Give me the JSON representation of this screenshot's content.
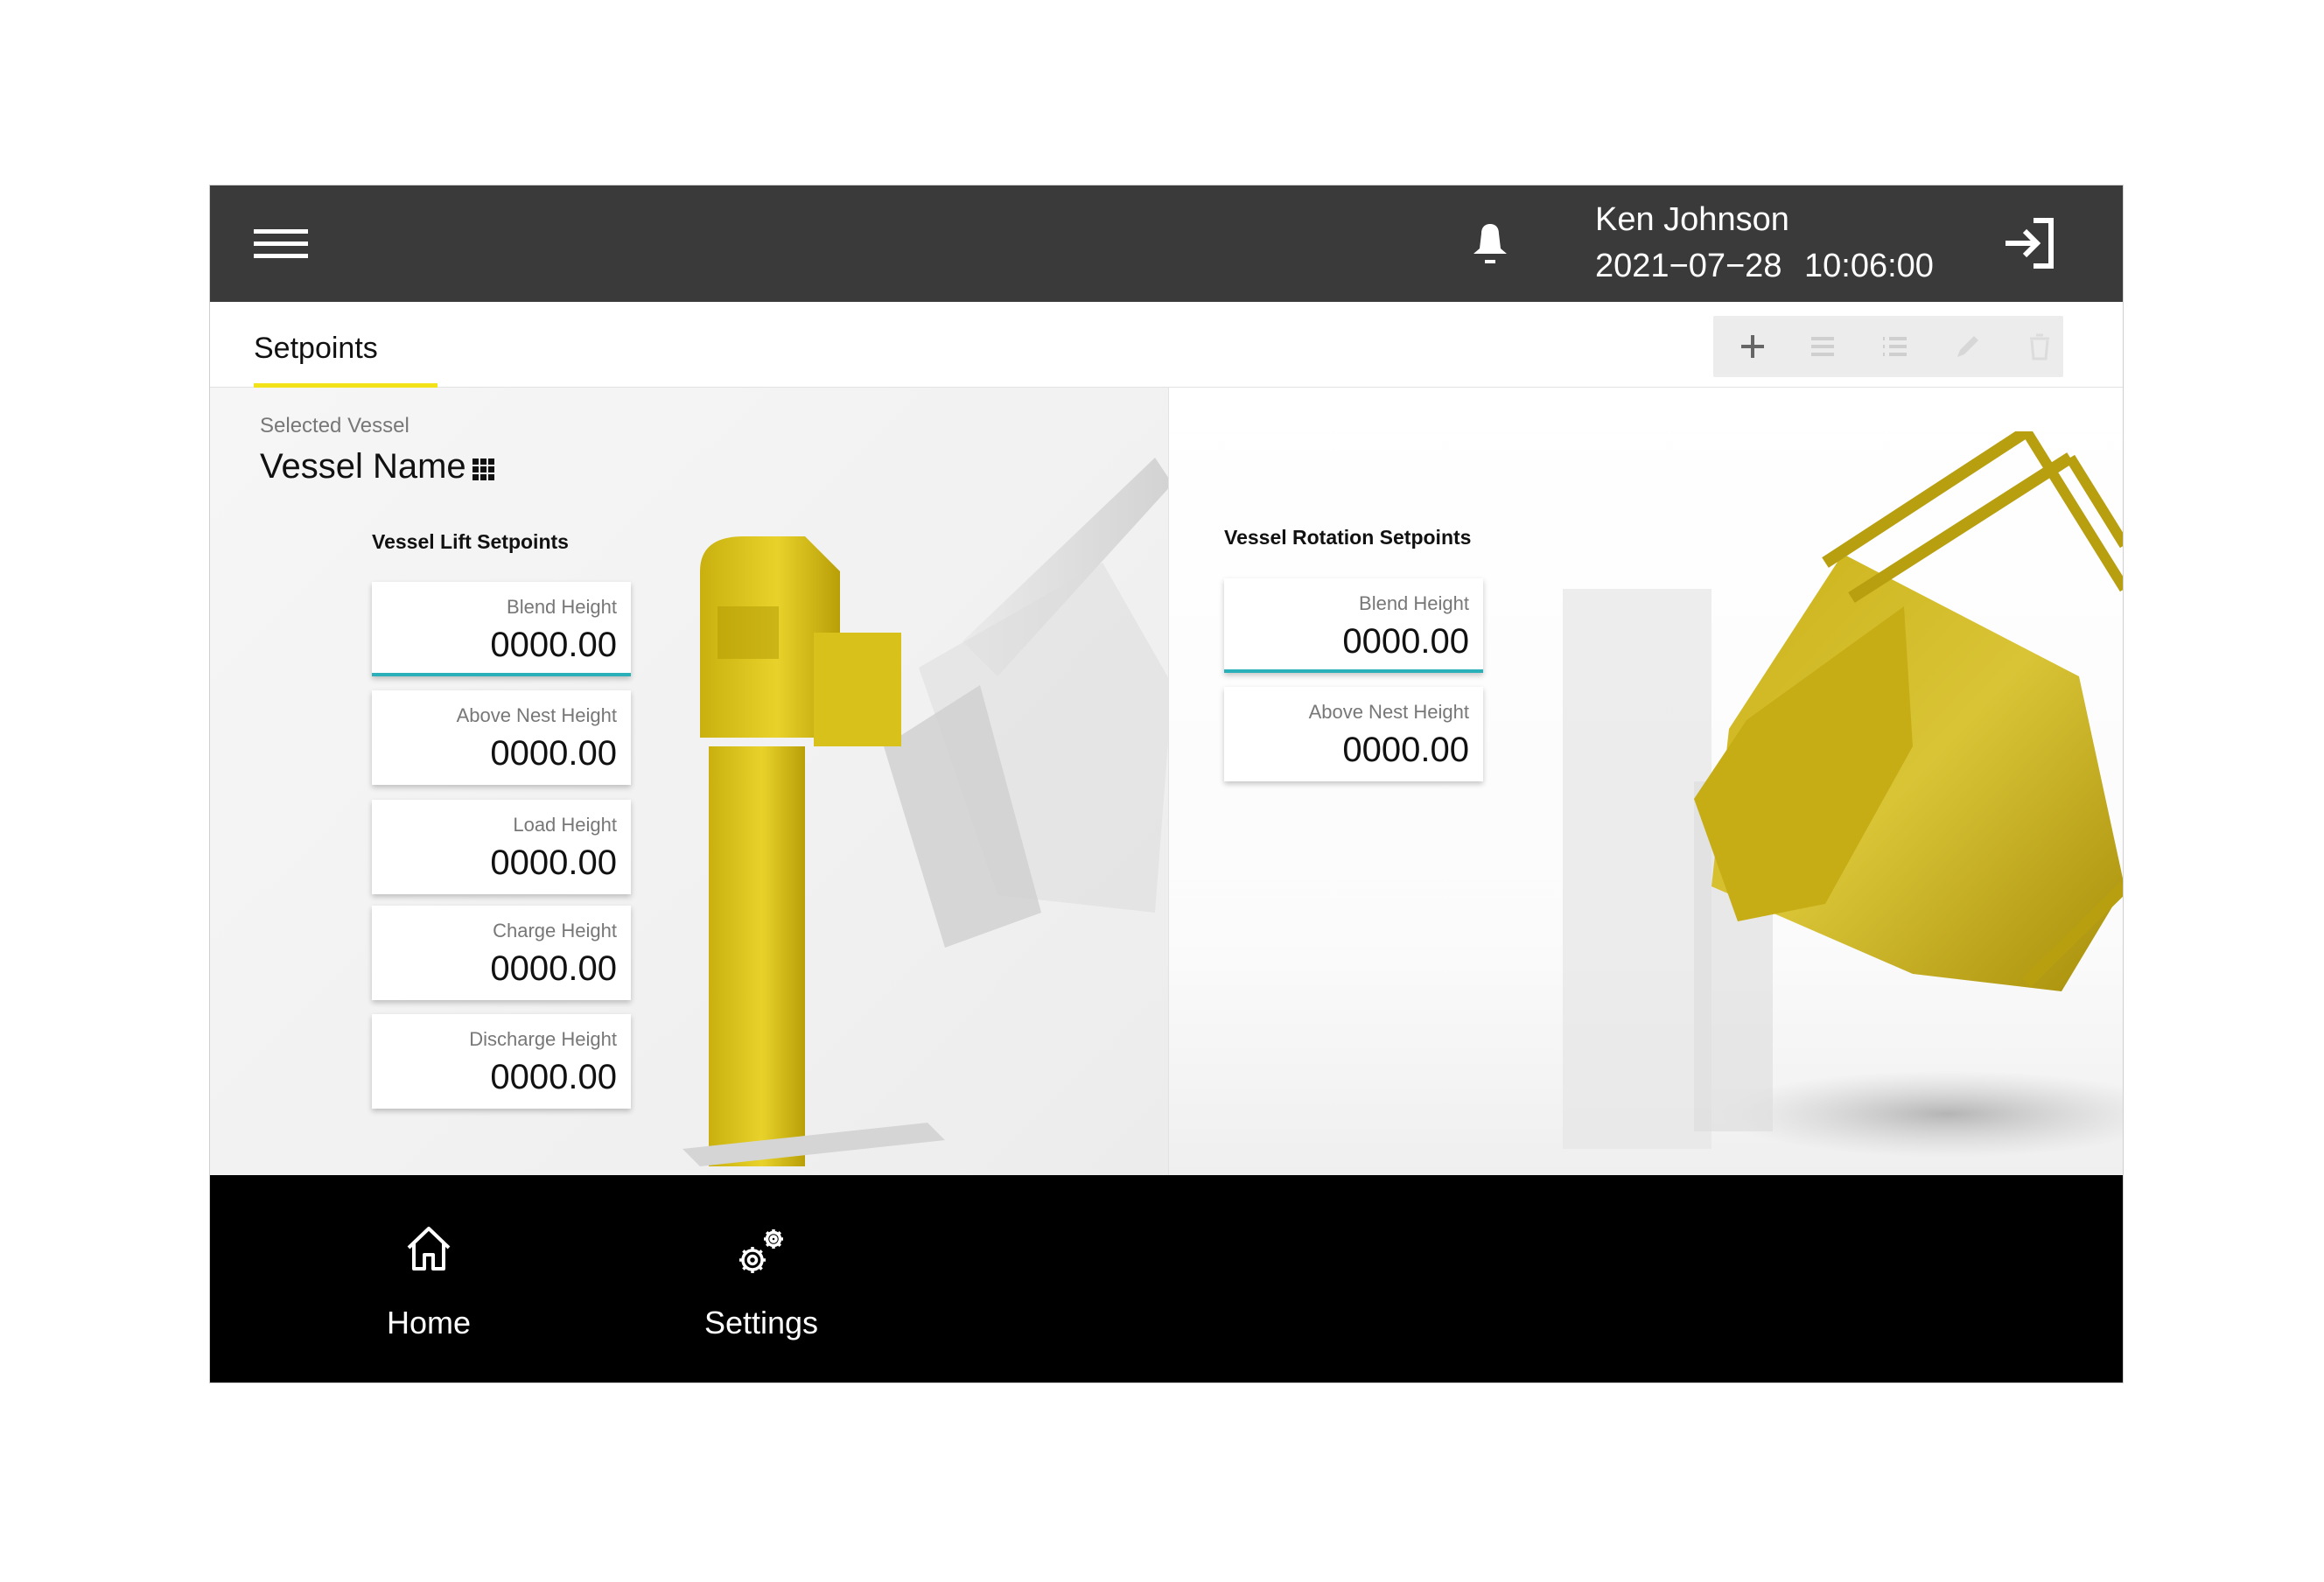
{
  "header": {
    "user_name": "Ken Johnson",
    "date": "2021−07−28",
    "time": "10:06:00",
    "icons": [
      "menu-icon",
      "bell-icon",
      "logout-icon"
    ]
  },
  "tabs": [
    {
      "label": "Setpoints",
      "active": true
    }
  ],
  "toolbar": {
    "icons": [
      "plus-icon",
      "list-icon",
      "checklist-icon",
      "edit-icon",
      "trash-icon"
    ]
  },
  "vessel": {
    "selected_label": "Selected Vessel",
    "name": "Vessel Name"
  },
  "lift": {
    "title": "Vessel Lift Setpoints",
    "fields": [
      {
        "label": "Blend Height",
        "value": "0000.00"
      },
      {
        "label": "Above Nest Height",
        "value": "0000.00"
      },
      {
        "label": "Load Height",
        "value": "0000.00"
      },
      {
        "label": "Charge Height",
        "value": "0000.00"
      },
      {
        "label": "Discharge Height",
        "value": "0000.00"
      }
    ]
  },
  "rotation": {
    "title": "Vessel Rotation Setpoints",
    "fields": [
      {
        "label": "Blend Height",
        "value": "0000.00"
      },
      {
        "label": "Above Nest Height",
        "value": "0000.00"
      }
    ]
  },
  "footer": {
    "nav": [
      {
        "label": "Home",
        "icon": "home-icon"
      },
      {
        "label": "Settings",
        "icon": "settings-icon"
      }
    ]
  },
  "colors": {
    "header_bg": "#3a3a3a",
    "tab_accent": "#f2e21a",
    "field_active": "#2ab0b8",
    "machine_yellow": "#d9c21c",
    "footer_bg": "#000000"
  }
}
